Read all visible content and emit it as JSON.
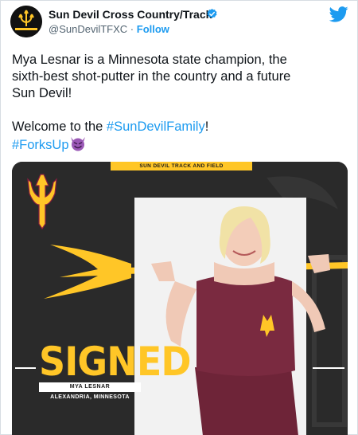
{
  "account": {
    "display_name": "Sun Devil Cross Country/Track",
    "handle": "@SunDevilTFXC",
    "separator": "·",
    "follow_label": "Follow",
    "avatar_icon": "trident-logo-icon",
    "verified_icon": "verified-badge-icon",
    "platform_icon": "twitter-bird-icon"
  },
  "tweet": {
    "text_line_1": "Mya Lesnar is a Minnesota state champion, the",
    "text_line_2": "sixth-best shot-putter in the country and a future",
    "text_line_3": "Sun Devil!",
    "welcome_text": "Welcome to the ",
    "hashtag_1": "#SunDevilFamily",
    "exclaim": "!",
    "hashtag_2": "#ForksUp",
    "emoji_icon": "smiling-devil-emoji-icon"
  },
  "media": {
    "banner_text": "SUN DEVIL TRACK AND FIELD",
    "headline": "SIGNED",
    "athlete_name": "MYA LESNAR",
    "athlete_hometown": "ALEXANDRIA, MINNESOTA"
  },
  "colors": {
    "brand_maroon": "#8c1d40",
    "brand_gold": "#ffc627",
    "link_blue": "#1d9bf0",
    "panel_dark": "#2a2a2a"
  }
}
